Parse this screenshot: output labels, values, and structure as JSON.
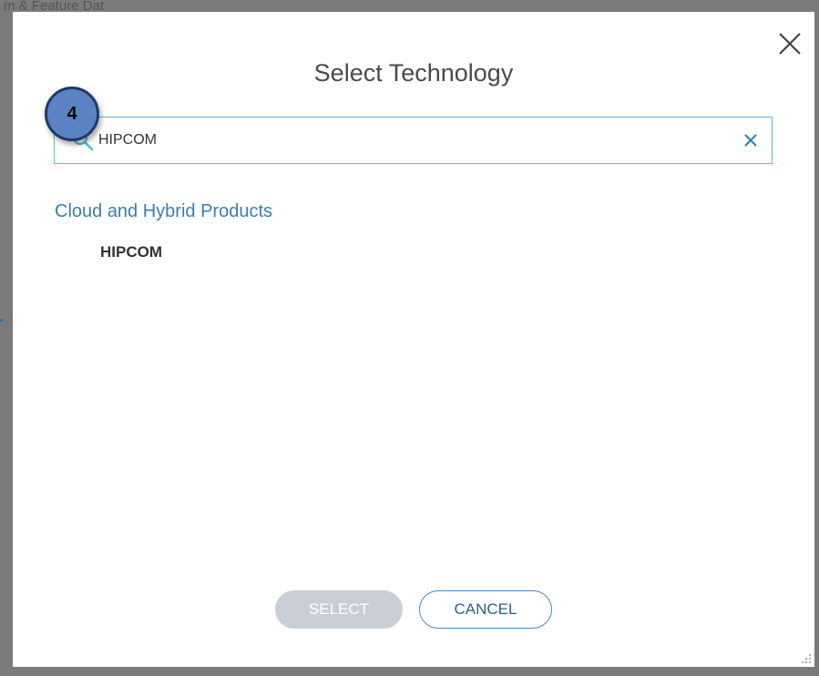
{
  "backdrop": {
    "fragment": "m & Feature Dat"
  },
  "dialog": {
    "title": "Select Technology",
    "step_badge": "4",
    "search": {
      "value": "HIPCOM",
      "placeholder": ""
    },
    "groups": [
      {
        "label": "Cloud and Hybrid Products",
        "items": [
          "HIPCOM"
        ]
      }
    ],
    "buttons": {
      "select_label": "SELECT",
      "cancel_label": "CANCEL"
    }
  },
  "icons": {
    "close": "close-icon",
    "search": "search-icon",
    "clear": "clear-icon",
    "resize": "resize-grip-icon"
  },
  "colors": {
    "accent": "#4fc0d8",
    "group_label": "#3b7fa8",
    "select_disabled": "#c9ced6",
    "badge_fill": "#5b83c4",
    "badge_border": "#213a6a"
  }
}
